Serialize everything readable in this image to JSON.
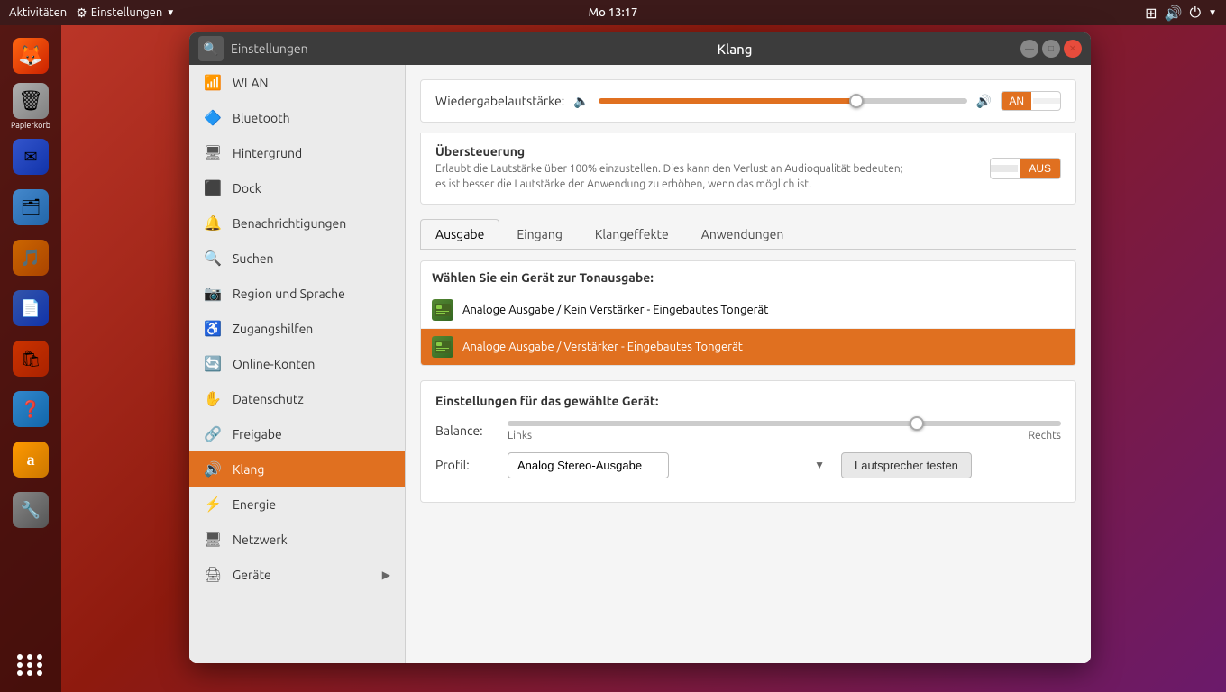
{
  "topbar": {
    "aktivitaten": "Aktivitäten",
    "einstellungen": "Einstellungen",
    "time": "Mo 13:17"
  },
  "dock": {
    "items": [
      {
        "name": "firefox",
        "label": "",
        "icon": "🦊"
      },
      {
        "name": "trash",
        "label": "Papierkorb",
        "icon": "🗑"
      },
      {
        "name": "thunderbird",
        "label": "",
        "icon": "🐦"
      },
      {
        "name": "files",
        "label": "",
        "icon": "🗂"
      },
      {
        "name": "rhythmbox",
        "label": "",
        "icon": "🎵"
      },
      {
        "name": "libreoffice",
        "label": "",
        "icon": "📄"
      },
      {
        "name": "appstore",
        "label": "",
        "icon": "🛍"
      },
      {
        "name": "help",
        "label": "",
        "icon": "❓"
      },
      {
        "name": "amazon",
        "label": "",
        "icon": "a"
      },
      {
        "name": "settings-tool",
        "label": "",
        "icon": "🔧"
      }
    ]
  },
  "window": {
    "app_name": "Einstellungen",
    "title": "Klang"
  },
  "sidebar": {
    "items": [
      {
        "id": "wlan",
        "label": "WLAN",
        "icon": "📶"
      },
      {
        "id": "bluetooth",
        "label": "Bluetooth",
        "icon": "🔷"
      },
      {
        "id": "hintergrund",
        "label": "Hintergrund",
        "icon": "🖥"
      },
      {
        "id": "dock",
        "label": "Dock",
        "icon": "⬛"
      },
      {
        "id": "benachrichtigungen",
        "label": "Benachrichtigungen",
        "icon": "🔔"
      },
      {
        "id": "suchen",
        "label": "Suchen",
        "icon": "🔍"
      },
      {
        "id": "region",
        "label": "Region und Sprache",
        "icon": "📷"
      },
      {
        "id": "zugangshilfen",
        "label": "Zugangshilfen",
        "icon": "♿"
      },
      {
        "id": "online-konten",
        "label": "Online-Konten",
        "icon": "🔄"
      },
      {
        "id": "datenschutz",
        "label": "Datenschutz",
        "icon": "✋"
      },
      {
        "id": "freigabe",
        "label": "Freigabe",
        "icon": "🔗"
      },
      {
        "id": "klang",
        "label": "Klang",
        "icon": "🔊"
      },
      {
        "id": "energie",
        "label": "Energie",
        "icon": "⚡"
      },
      {
        "id": "netzwerk",
        "label": "Netzwerk",
        "icon": "🖥"
      },
      {
        "id": "geraete",
        "label": "Geräte",
        "icon": "🖨"
      }
    ]
  },
  "main": {
    "volume": {
      "label": "Wiedergabelautstärke:",
      "level": 70,
      "toggle_on": "AN",
      "toggle_off": ""
    },
    "oversteering": {
      "title": "Übersteuerung",
      "description": "Erlaubt die Lautstärke über 100% einzustellen. Dies kann den Verlust an Audioqualität bedeuten;\nes ist besser die Lautstärke der Anwendung zu erhöhen, wenn das möglich ist.",
      "toggle_off": "AUS",
      "toggle_on": ""
    },
    "tabs": [
      {
        "id": "ausgabe",
        "label": "Ausgabe",
        "active": true
      },
      {
        "id": "eingang",
        "label": "Eingang",
        "active": false
      },
      {
        "id": "klangeffekte",
        "label": "Klangeffekte",
        "active": false
      },
      {
        "id": "anwendungen",
        "label": "Anwendungen",
        "active": false
      }
    ],
    "device_section": {
      "title": "Wählen Sie ein Gerät zur Tonausgabe:",
      "devices": [
        {
          "id": "device1",
          "label": "Analoge Ausgabe / Kein Verstärker - Eingebautes Tongerät",
          "selected": false
        },
        {
          "id": "device2",
          "label": "Analoge Ausgabe / Verstärker - Eingebautes Tongerät",
          "selected": true
        }
      ]
    },
    "device_settings": {
      "title": "Einstellungen für das gewählte Gerät:",
      "balance_label": "Balance:",
      "balance_left": "Links",
      "balance_right": "Rechts",
      "balance_level": 74,
      "profil_label": "Profil:",
      "profil_options": [
        {
          "value": "analog-stereo",
          "label": "Analog Stereo-Ausgabe"
        }
      ],
      "profil_selected": "Analog Stereo-Ausgabe",
      "test_button": "Lautsprecher testen"
    }
  }
}
